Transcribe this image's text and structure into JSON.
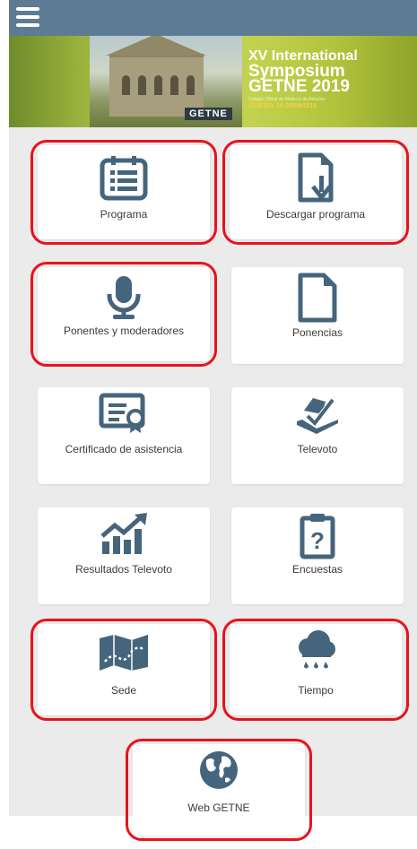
{
  "banner": {
    "line1": "XV International",
    "line2": "Symposium",
    "line3": "GETNE 2019",
    "subtitle": "Colegio Oficial de Médicos de Asturias",
    "date": "OVIEDO, 19-20/09/2019",
    "logo": "GETNE"
  },
  "tiles": [
    {
      "label": "Programa",
      "icon": "calendar-list-icon"
    },
    {
      "label": "Descargar programa",
      "icon": "document-download-icon"
    },
    {
      "label": "Ponentes y moderadores",
      "icon": "microphone-icon"
    },
    {
      "label": "Ponencias",
      "icon": "document-icon"
    },
    {
      "label": "Certificado de asistencia",
      "icon": "certificate-icon"
    },
    {
      "label": "Televoto",
      "icon": "vote-box-icon"
    },
    {
      "label": "Resultados Televoto",
      "icon": "trend-chart-icon"
    },
    {
      "label": "Encuestas",
      "icon": "survey-clipboard-icon"
    },
    {
      "label": "Sede",
      "icon": "map-icon"
    },
    {
      "label": "Tiempo",
      "icon": "rain-cloud-icon"
    },
    {
      "label": "Web GETNE",
      "icon": "globe-icon"
    }
  ],
  "colors": {
    "topbar": "#5d7c93",
    "icon": "#45657d",
    "highlight": "#e8131b"
  }
}
